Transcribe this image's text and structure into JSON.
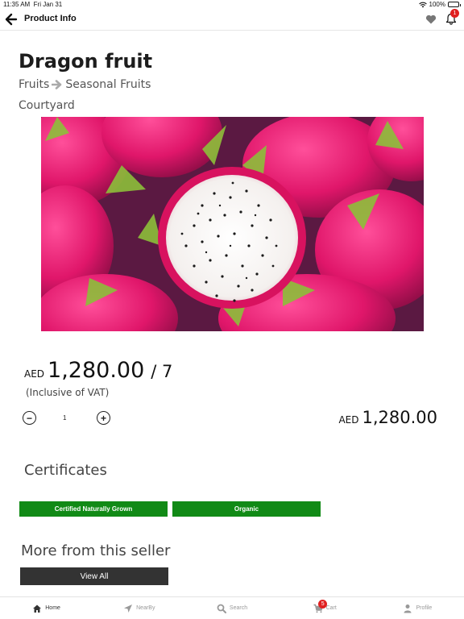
{
  "status_bar": {
    "time": "11:35 AM",
    "date": "Fri Jan 31",
    "battery": "100%"
  },
  "nav": {
    "title": "Product Info",
    "notification_count": "1"
  },
  "product": {
    "name": "Dragon fruit",
    "category": "Fruits",
    "subcategory": "Seasonal Fruits",
    "location": "Courtyard",
    "image": "dragon-fruit-photo"
  },
  "price": {
    "currency": "AED",
    "amount": "1,280.00",
    "per": "/ 7",
    "vat_note": "(Inclusive of VAT)"
  },
  "quantity": {
    "value": "1"
  },
  "total": {
    "currency": "AED",
    "amount": "1,280.00"
  },
  "certificates": {
    "title": "Certificates",
    "items": [
      "Certified Naturally Grown",
      "Organic"
    ],
    "color": "#118a16"
  },
  "seller": {
    "title": "More from this seller",
    "view_all_label": "View All"
  },
  "tabbar": {
    "items": [
      {
        "label": "Home",
        "icon": "home-icon",
        "active": true
      },
      {
        "label": "NearBy",
        "icon": "location-arrow-icon"
      },
      {
        "label": "Search",
        "icon": "search-icon"
      },
      {
        "label": "Cart",
        "icon": "cart-icon",
        "badge": "5"
      },
      {
        "label": "Profile",
        "icon": "user-icon"
      }
    ]
  }
}
